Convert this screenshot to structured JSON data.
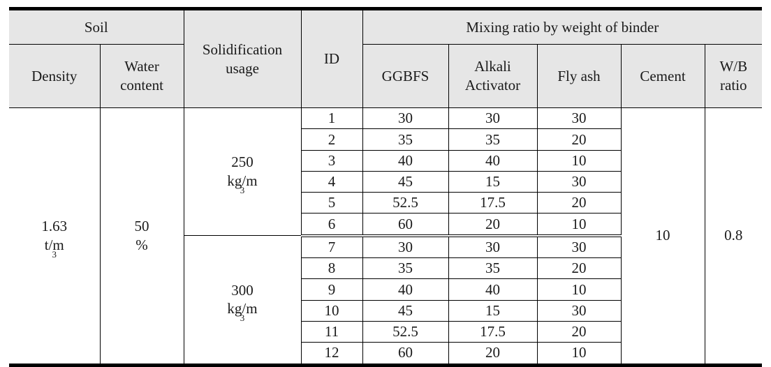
{
  "table": {
    "header": {
      "group_soil": "Soil",
      "group_mixing": "Mixing ratio by weight of binder",
      "density": "Density",
      "water_content_l1": "Water",
      "water_content_l2": "content",
      "solidification_l1": "Solidification",
      "solidification_l2": "usage",
      "id": "ID",
      "ggbfs": "GGBFS",
      "alkali_l1": "Alkali",
      "alkali_l2": "Activator",
      "fly_ash": "Fly ash",
      "cement": "Cement",
      "wb_l1": "W/B",
      "wb_l2": "ratio"
    },
    "merged": {
      "density_value": "1.63",
      "density_unit_base": "t/m",
      "density_unit_exp": "3",
      "water_content_value": "50",
      "water_content_unit": "%",
      "solidification_a_value": "250",
      "solidification_a_unit_base": "kg/m",
      "solidification_a_unit_exp": "3",
      "solidification_b_value": "300",
      "solidification_b_unit_base": "kg/m",
      "solidification_b_unit_exp": "3",
      "cement_value": "10",
      "wb_value": "0.8"
    },
    "columns": [
      "ID",
      "GGBFS",
      "Alkali Activator",
      "Fly ash"
    ],
    "rows": [
      {
        "id": "1",
        "ggbfs": "30",
        "alkali": "30",
        "fly_ash": "30"
      },
      {
        "id": "2",
        "ggbfs": "35",
        "alkali": "35",
        "fly_ash": "20"
      },
      {
        "id": "3",
        "ggbfs": "40",
        "alkali": "40",
        "fly_ash": "10"
      },
      {
        "id": "4",
        "ggbfs": "45",
        "alkali": "15",
        "fly_ash": "30"
      },
      {
        "id": "5",
        "ggbfs": "52.5",
        "alkali": "17.5",
        "fly_ash": "20"
      },
      {
        "id": "6",
        "ggbfs": "60",
        "alkali": "20",
        "fly_ash": "10"
      },
      {
        "id": "7",
        "ggbfs": "30",
        "alkali": "30",
        "fly_ash": "30"
      },
      {
        "id": "8",
        "ggbfs": "35",
        "alkali": "35",
        "fly_ash": "20"
      },
      {
        "id": "9",
        "ggbfs": "40",
        "alkali": "40",
        "fly_ash": "10"
      },
      {
        "id": "10",
        "ggbfs": "45",
        "alkali": "15",
        "fly_ash": "30"
      },
      {
        "id": "11",
        "ggbfs": "52.5",
        "alkali": "17.5",
        "fly_ash": "20"
      },
      {
        "id": "12",
        "ggbfs": "60",
        "alkali": "20",
        "fly_ash": "10"
      }
    ]
  }
}
